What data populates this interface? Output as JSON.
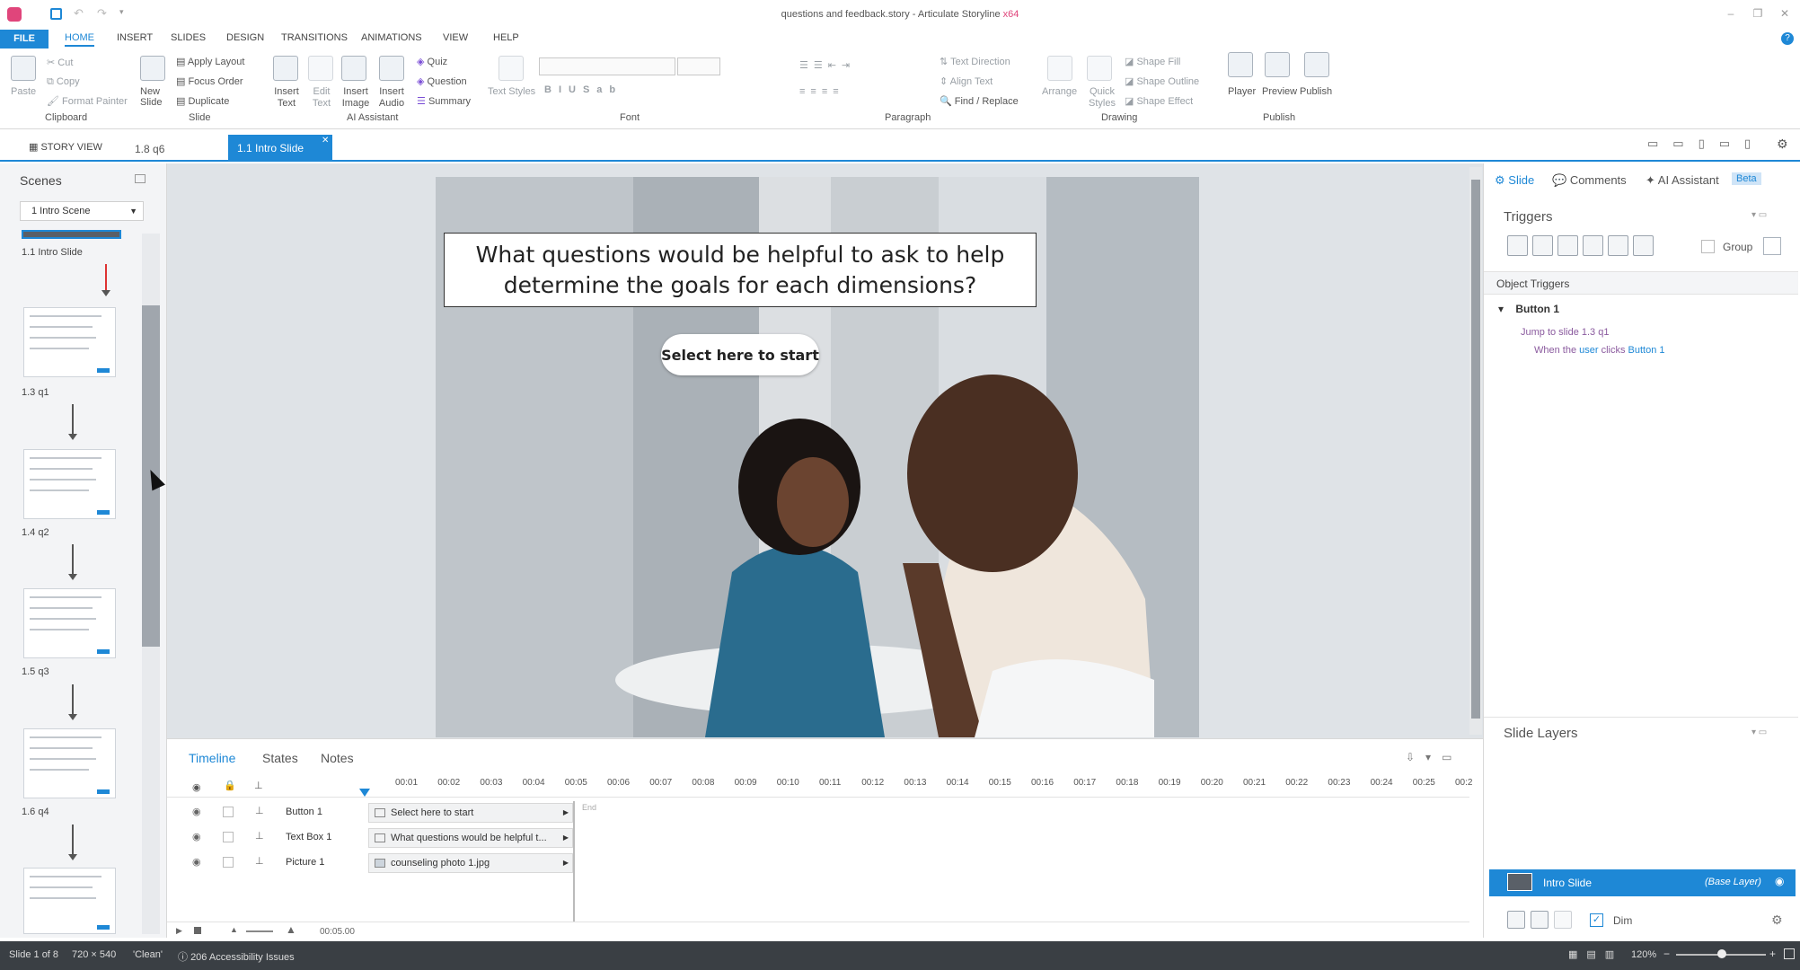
{
  "window": {
    "title": "questions and feedback.story - Articulate Storyline ",
    "title_accent": "x64"
  },
  "menu": {
    "file": "FILE",
    "tabs": [
      "HOME",
      "INSERT",
      "SLIDES",
      "DESIGN",
      "TRANSITIONS",
      "ANIMATIONS",
      "VIEW",
      "HELP"
    ]
  },
  "ribbon": {
    "clipboard": {
      "paste": "Paste",
      "cut": "Cut",
      "copy": "Copy",
      "format_painter": "Format Painter",
      "label": "Clipboard"
    },
    "slide": {
      "new_slide": "New Slide",
      "apply_layout": "Apply Layout",
      "focus_order": "Focus Order",
      "duplicate": "Duplicate",
      "label": "Slide"
    },
    "ai": {
      "insert_text": "Insert Text",
      "edit_text": "Edit Text",
      "insert_image": "Insert Image",
      "insert_audio": "Insert Audio",
      "quiz": "Quiz",
      "question": "Question",
      "summary": "Summary",
      "label": "AI Assistant"
    },
    "font": {
      "text_styles": "Text Styles",
      "label": "Font"
    },
    "paragraph": {
      "text_direction": "Text Direction",
      "align_text": "Align Text",
      "find_replace": "Find / Replace",
      "label": "Paragraph"
    },
    "drawing": {
      "arrange": "Arrange",
      "quick_styles": "Quick Styles",
      "shape_fill": "Shape Fill",
      "shape_outline": "Shape Outline",
      "shape_effect": "Shape Effect",
      "label": "Drawing"
    },
    "publish": {
      "player": "Player",
      "preview": "Preview",
      "publish": "Publish",
      "label": "Publish"
    }
  },
  "doc_tabs": {
    "story_view": "STORY VIEW",
    "tab2": "1.8 q6",
    "active": "1.1 Intro Slide"
  },
  "scenes": {
    "title": "Scenes",
    "dropdown": "1 Intro Scene",
    "slides": [
      "1.1 Intro Slide",
      "1.3 q1",
      "1.4 q2",
      "1.5 q3",
      "1.6 q4"
    ]
  },
  "slide": {
    "question": "What questions would be helpful to ask to help determine the goals for each dimensions?",
    "button": "Select here to start"
  },
  "timeline": {
    "tabs": [
      "Timeline",
      "States",
      "Notes"
    ],
    "ticks": [
      "00:01",
      "00:02",
      "00:03",
      "00:04",
      "00:05",
      "00:06",
      "00:07",
      "00:08",
      "00:09",
      "00:10",
      "00:11",
      "00:12",
      "00:13",
      "00:14",
      "00:15",
      "00:16",
      "00:17",
      "00:18",
      "00:19",
      "00:20",
      "00:21",
      "00:22",
      "00:23",
      "00:24",
      "00:25",
      "00:2"
    ],
    "rows": [
      {
        "name": "Button 1",
        "content": "Select here to start"
      },
      {
        "name": "Text Box 1",
        "content": "What questions would be helpful t..."
      },
      {
        "name": "Picture 1",
        "content": "counseling photo 1.jpg"
      }
    ],
    "end_label": "End",
    "duration": "00:05.00"
  },
  "right_panel": {
    "tabs": {
      "slide": "Slide",
      "comments": "Comments",
      "ai": "AI Assistant",
      "beta": "Beta"
    },
    "triggers_title": "Triggers",
    "group": "Group",
    "object_triggers": "Object Triggers",
    "button_name": "Button 1",
    "action_text": "Jump to slide 1.3 q1",
    "when_prefix": "When the ",
    "when_user": "user",
    "when_mid": " clicks ",
    "when_object": "Button 1",
    "slide_layers": "Slide Layers",
    "base_layer_name": "Intro Slide",
    "base_layer_tag": "(Base Layer)",
    "dim": "Dim"
  },
  "status": {
    "slide": "Slide 1 of 8",
    "size": "720 × 540",
    "theme": "'Clean'",
    "issues": "206 Accessibility Issues",
    "zoom": "120%"
  },
  "colors": {
    "accent": "#1e88d6",
    "status_bg": "#3a3f44"
  }
}
